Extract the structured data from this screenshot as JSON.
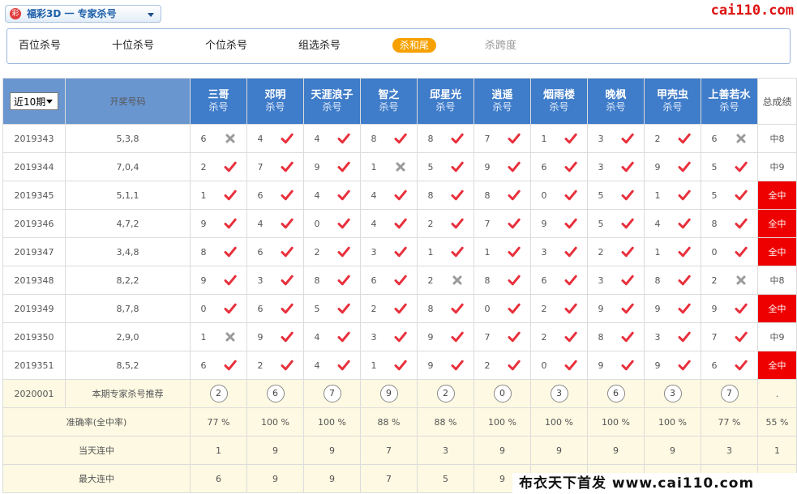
{
  "header": {
    "logo_char": "彩",
    "title": "福彩3D 一 专家杀号",
    "site": "cai110.com"
  },
  "tabs": [
    {
      "label": "百位杀号",
      "state": "normal"
    },
    {
      "label": "十位杀号",
      "state": "normal"
    },
    {
      "label": "个位杀号",
      "state": "normal"
    },
    {
      "label": "组选杀号",
      "state": "normal"
    },
    {
      "label": "杀和尾",
      "state": "active"
    },
    {
      "label": "杀跨度",
      "state": "muted"
    }
  ],
  "table": {
    "period_select": "近10期",
    "col_open": "开奖号码",
    "col_total": "总成绩",
    "kill_label": "杀号",
    "experts": [
      "三哥",
      "邓明",
      "天涯浪子",
      "智之",
      "邱星光",
      "逍遥",
      "烟雨楼",
      "晚枫",
      "甲壳虫",
      "上善若水"
    ],
    "rows": [
      {
        "issue": "2019343",
        "open": "5,3,8",
        "nums": [
          6,
          4,
          4,
          8,
          8,
          7,
          1,
          3,
          2,
          6
        ],
        "hits": [
          0,
          1,
          1,
          1,
          1,
          1,
          1,
          1,
          1,
          0
        ],
        "total": "中8",
        "all": false
      },
      {
        "issue": "2019344",
        "open": "7,0,4",
        "nums": [
          2,
          7,
          9,
          1,
          5,
          9,
          6,
          3,
          9,
          5
        ],
        "hits": [
          1,
          1,
          1,
          0,
          1,
          1,
          1,
          1,
          1,
          1
        ],
        "total": "中9",
        "all": false
      },
      {
        "issue": "2019345",
        "open": "5,1,1",
        "nums": [
          1,
          6,
          4,
          4,
          8,
          8,
          0,
          5,
          1,
          5
        ],
        "hits": [
          1,
          1,
          1,
          1,
          1,
          1,
          1,
          1,
          1,
          1
        ],
        "total": "全中",
        "all": true
      },
      {
        "issue": "2019346",
        "open": "4,7,2",
        "nums": [
          9,
          4,
          0,
          4,
          2,
          7,
          9,
          5,
          4,
          8
        ],
        "hits": [
          1,
          1,
          1,
          1,
          1,
          1,
          1,
          1,
          1,
          1
        ],
        "total": "全中",
        "all": true
      },
      {
        "issue": "2019347",
        "open": "3,4,8",
        "nums": [
          8,
          6,
          2,
          3,
          1,
          1,
          3,
          2,
          1,
          0
        ],
        "hits": [
          1,
          1,
          1,
          1,
          1,
          1,
          1,
          1,
          1,
          1
        ],
        "total": "全中",
        "all": true
      },
      {
        "issue": "2019348",
        "open": "8,2,2",
        "nums": [
          9,
          3,
          8,
          6,
          2,
          8,
          6,
          3,
          8,
          2
        ],
        "hits": [
          1,
          1,
          1,
          1,
          0,
          1,
          1,
          1,
          1,
          0
        ],
        "total": "中8",
        "all": false
      },
      {
        "issue": "2019349",
        "open": "8,7,8",
        "nums": [
          0,
          6,
          5,
          2,
          8,
          0,
          2,
          9,
          9,
          9
        ],
        "hits": [
          1,
          1,
          1,
          1,
          1,
          1,
          1,
          1,
          1,
          1
        ],
        "total": "全中",
        "all": true
      },
      {
        "issue": "2019350",
        "open": "2,9,0",
        "nums": [
          1,
          9,
          4,
          3,
          9,
          7,
          2,
          8,
          3,
          7
        ],
        "hits": [
          0,
          1,
          1,
          1,
          1,
          1,
          1,
          1,
          1,
          1
        ],
        "total": "中9",
        "all": false
      },
      {
        "issue": "2019351",
        "open": "8,5,2",
        "nums": [
          6,
          2,
          4,
          1,
          9,
          2,
          0,
          9,
          9,
          6
        ],
        "hits": [
          1,
          1,
          1,
          1,
          1,
          1,
          1,
          1,
          1,
          1
        ],
        "total": "全中",
        "all": true
      }
    ],
    "recommend": {
      "issue": "2020001",
      "label": "本期专家杀号推荐",
      "nums": [
        "2",
        "6",
        "7",
        "9",
        "2",
        "0",
        "3",
        "6",
        "3",
        "7"
      ],
      "total": "."
    },
    "accuracy": {
      "label": "准确率(全中率)",
      "values": [
        "77 %",
        "100 %",
        "100 %",
        "88 %",
        "88 %",
        "100 %",
        "100 %",
        "100 %",
        "100 %",
        "77 %"
      ],
      "total": "55 %"
    },
    "current_streak": {
      "label": "当天连中",
      "values": [
        "1",
        "9",
        "9",
        "7",
        "3",
        "9",
        "9",
        "9",
        "9",
        "3"
      ],
      "total": "1"
    },
    "max_streak": {
      "label": "最大连中",
      "values": [
        "6",
        "9",
        "9",
        "7",
        "5",
        "9",
        "",
        "",
        "",
        ""
      ],
      "total": ""
    }
  },
  "banner": "布衣天下首发 www.cai110.com",
  "colors": {
    "header_blue": "#3f7cc9",
    "hit_red": "#e8303c",
    "miss_gray": "#9a9a9a",
    "all_hit_bg": "#ee0000",
    "tab_active": "#f7a100"
  }
}
